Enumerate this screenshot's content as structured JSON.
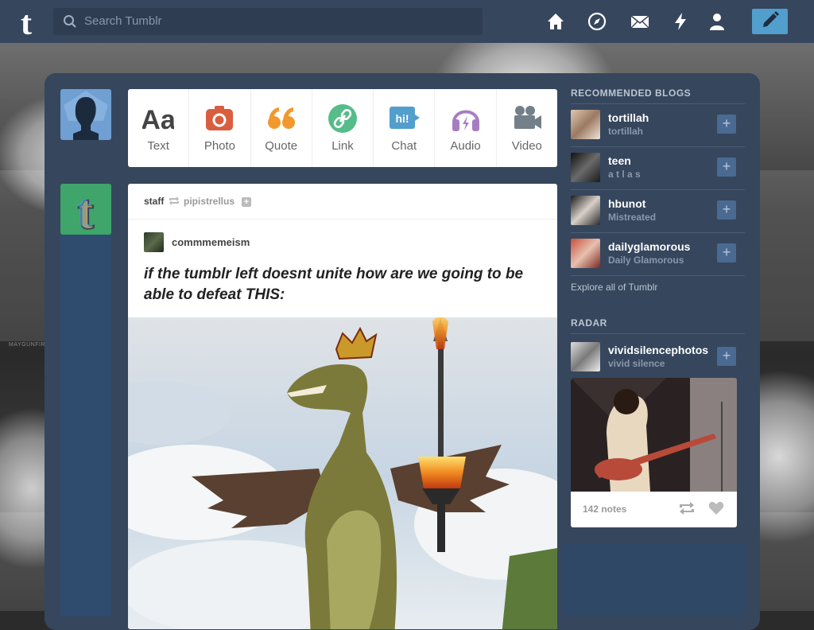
{
  "search": {
    "placeholder": "Search Tumblr"
  },
  "nav": {
    "icons": [
      "home-icon",
      "explore-icon",
      "inbox-icon",
      "activity-icon",
      "account-icon",
      "compose-icon"
    ]
  },
  "post_types": [
    {
      "label": "Text",
      "icon": "text-icon",
      "color": "#444444"
    },
    {
      "label": "Photo",
      "icon": "photo-icon",
      "color": "#d95e40"
    },
    {
      "label": "Quote",
      "icon": "quote-icon",
      "color": "#f2992e"
    },
    {
      "label": "Link",
      "icon": "link-icon",
      "color": "#56bc8a"
    },
    {
      "label": "Chat",
      "icon": "chat-icon",
      "color": "#529ecc"
    },
    {
      "label": "Audio",
      "icon": "audio-icon",
      "color": "#a77dc2"
    },
    {
      "label": "Video",
      "icon": "video-icon",
      "color": "#748089"
    }
  ],
  "post": {
    "reblogger": "staff",
    "reblogged_from": "pipistrellus",
    "source": "commmemeism",
    "title": "if the tumblr left doesnt unite how are we going to be able to defeat THIS:"
  },
  "recommended": {
    "title": "RECOMMENDED BLOGS",
    "blogs": [
      {
        "name": "tortillah",
        "title": "tortillah"
      },
      {
        "name": "teen",
        "title": "a t l a s"
      },
      {
        "name": "hbunot",
        "title": "Mistreated"
      },
      {
        "name": "dailyglamorous",
        "title": "Daily Glamorous"
      }
    ],
    "explore": "Explore all of Tumblr"
  },
  "radar": {
    "title": "RADAR",
    "blog": "vividsilencephotos",
    "blog_title": "vivid silence",
    "notes": "142 notes"
  },
  "background": {
    "watermark": "MAYGUNFIRE"
  },
  "colors": {
    "topbar": "#36465d",
    "accent": "#529ecc"
  }
}
